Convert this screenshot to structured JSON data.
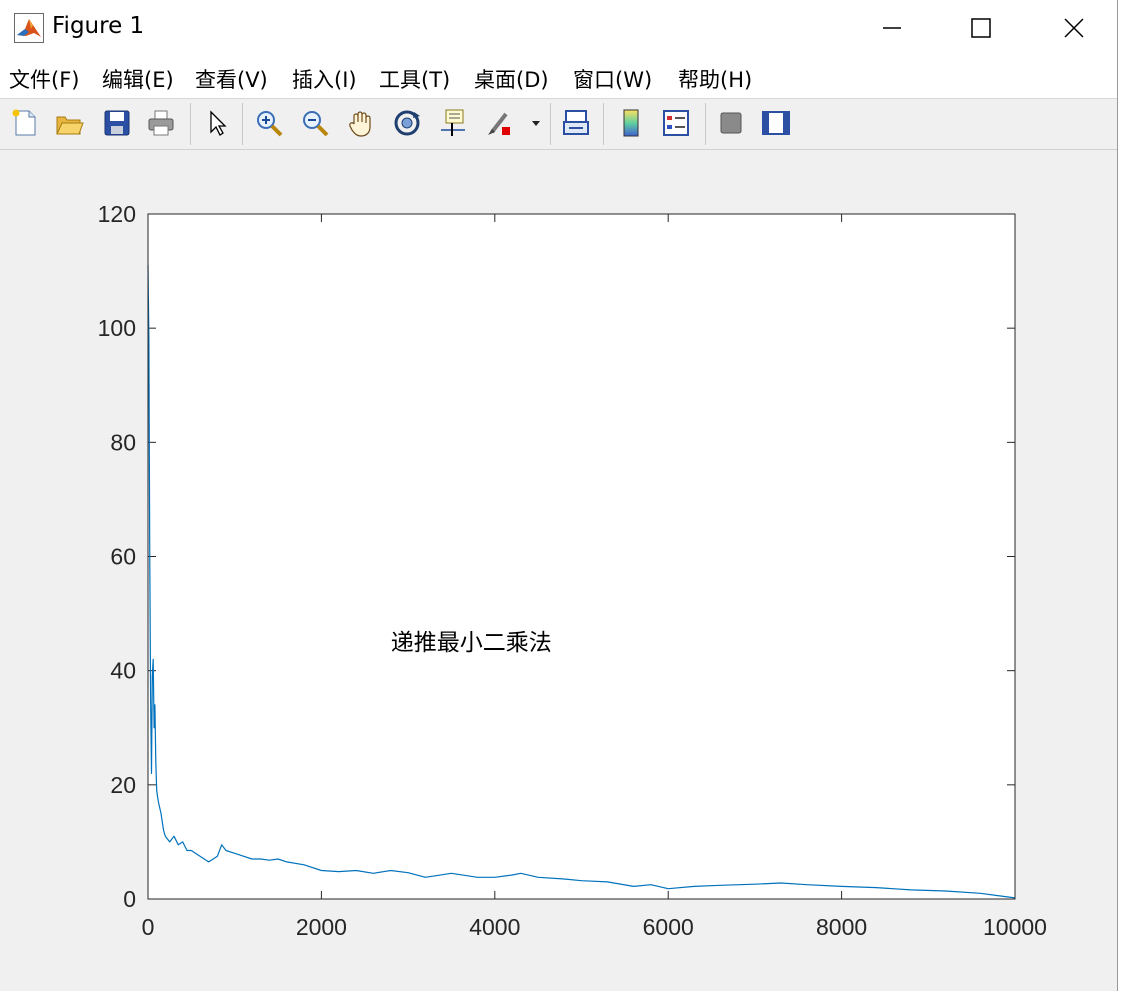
{
  "window": {
    "title": "Figure 1"
  },
  "menu": [
    "文件(F)",
    "编辑(E)",
    "查看(V)",
    "插入(I)",
    "工具(T)",
    "桌面(D)",
    "窗口(W)",
    "帮助(H)"
  ],
  "toolbar": {
    "buttons": [
      "new-figure-icon",
      "open-file-icon",
      "save-icon",
      "print-icon",
      "select-arrow-icon",
      "zoom-in-icon",
      "zoom-out-icon",
      "pan-hand-icon",
      "rotate-3d-icon",
      "data-cursor-icon",
      "brush-icon",
      "link-plot-icon",
      "colorbar-icon",
      "legend-icon",
      "hide-plot-tools-icon",
      "show-plot-tools-icon"
    ]
  },
  "colors": {
    "line": "#0072bd",
    "axes": "#262626",
    "figure_bg": "#f0f0f0"
  },
  "chart_data": {
    "type": "line",
    "title": "",
    "xlabel": "",
    "ylabel": "",
    "xlim": [
      0,
      10000
    ],
    "ylim": [
      0,
      120
    ],
    "xticks": [
      0,
      2000,
      4000,
      6000,
      8000,
      10000
    ],
    "yticks": [
      0,
      20,
      40,
      60,
      80,
      100,
      120
    ],
    "grid": false,
    "annotation": {
      "text": "递推最小二乘法",
      "x": 2800,
      "y": 45
    },
    "series": [
      {
        "x": [
          0,
          10,
          20,
          30,
          40,
          50,
          60,
          70,
          80,
          90,
          100,
          110,
          120,
          150,
          180,
          200,
          250,
          300,
          350,
          400,
          450,
          500,
          600,
          700,
          800,
          850,
          900,
          1000,
          1100,
          1200,
          1300,
          1400,
          1500,
          1600,
          1800,
          2000,
          2200,
          2400,
          2600,
          2800,
          3000,
          3200,
          3500,
          3800,
          4000,
          4200,
          4300,
          4500,
          4800,
          5000,
          5300,
          5600,
          5800,
          6000,
          6300,
          6600,
          7000,
          7300,
          7600,
          8000,
          8400,
          8800,
          9200,
          9600,
          9800,
          10000
        ],
        "values": [
          111,
          98,
          62,
          35,
          22,
          39,
          42,
          30,
          34,
          24,
          19,
          18,
          17,
          15,
          12,
          11,
          10,
          11,
          9.5,
          10,
          8.5,
          8.5,
          7.5,
          6.5,
          7.5,
          9.5,
          8.5,
          8,
          7.5,
          7,
          7,
          6.8,
          7,
          6.5,
          6,
          5,
          4.8,
          5,
          4.5,
          5,
          4.6,
          3.8,
          4.5,
          3.8,
          3.8,
          4.2,
          4.5,
          3.8,
          3.5,
          3.2,
          3,
          2.2,
          2.5,
          1.8,
          2.2,
          2.4,
          2.6,
          2.8,
          2.5,
          2.2,
          2.0,
          1.6,
          1.4,
          1.0,
          0.6,
          0.2
        ]
      }
    ]
  }
}
